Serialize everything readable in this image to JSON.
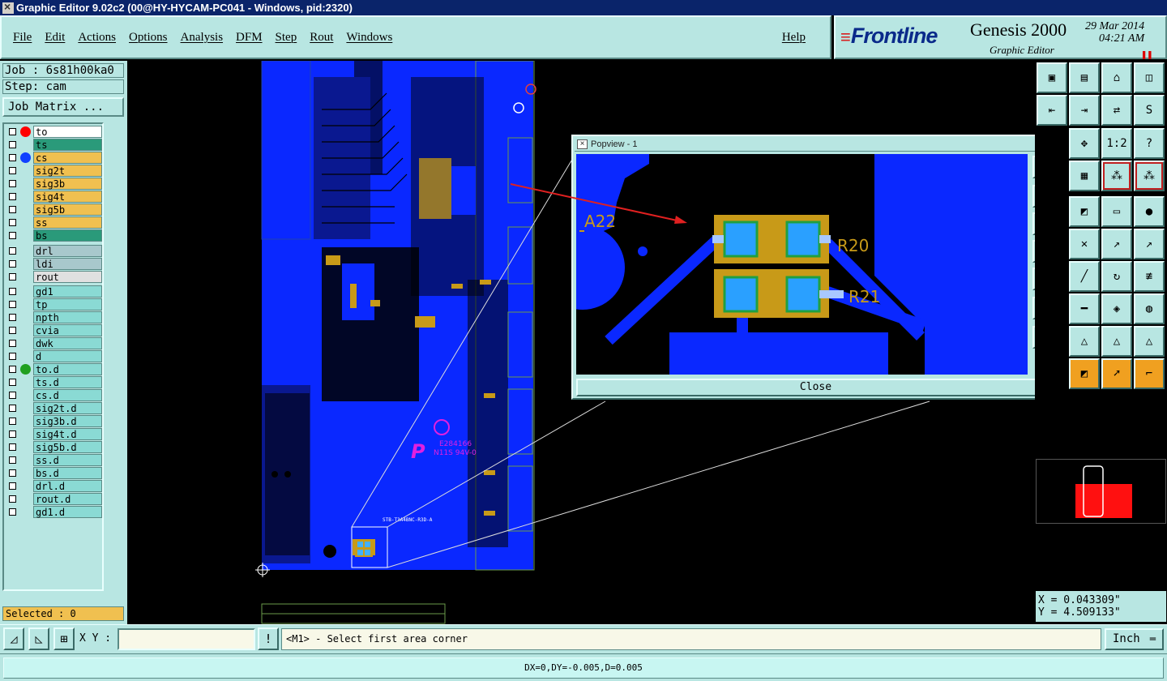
{
  "window": {
    "title": "Graphic Editor 9.02c2 (00@HY-HYCAM-PC041 - Windows, pid:2320)"
  },
  "menu": {
    "items": [
      "File",
      "Edit",
      "Actions",
      "Options",
      "Analysis",
      "DFM",
      "Step",
      "Rout",
      "Windows"
    ],
    "help": "Help"
  },
  "brand": {
    "logo": "Frontline",
    "product": "Genesis 2000",
    "subtitle": "Graphic Editor",
    "date": "29 Mar 2014",
    "time": "04:21 AM"
  },
  "job": {
    "job_label": "Job : 6s81h00ka0",
    "step_label": "Step: cam",
    "matrix_button": "Job Matrix ..."
  },
  "layers": [
    {
      "name": "to",
      "color": "#ffffff",
      "dot": "#ff0000",
      "group": 0
    },
    {
      "name": "ts",
      "color": "#2a9a7a",
      "dot": "",
      "group": 0
    },
    {
      "name": "cs",
      "color": "#f0c050",
      "dot": "#1040ff",
      "group": 0
    },
    {
      "name": "sig2t",
      "color": "#f0c050",
      "dot": "",
      "group": 0
    },
    {
      "name": "sig3b",
      "color": "#f0c050",
      "dot": "",
      "group": 0
    },
    {
      "name": "sig4t",
      "color": "#f0c050",
      "dot": "",
      "group": 0
    },
    {
      "name": "sig5b",
      "color": "#f0c050",
      "dot": "",
      "group": 0
    },
    {
      "name": "ss",
      "color": "#f0c050",
      "dot": "",
      "group": 0
    },
    {
      "name": "bs",
      "color": "#2a9a7a",
      "dot": "",
      "group": 0
    },
    {
      "name": "drl",
      "color": "#a8c8cc",
      "dot": "",
      "group": 1
    },
    {
      "name": "ldi",
      "color": "#a8c8cc",
      "dot": "",
      "group": 1
    },
    {
      "name": "rout",
      "color": "#e0e0e0",
      "dot": "",
      "group": 1
    },
    {
      "name": "gd1",
      "color": "#8adad4",
      "dot": "",
      "group": 2
    },
    {
      "name": "tp",
      "color": "#8adad4",
      "dot": "",
      "group": 2
    },
    {
      "name": "npth",
      "color": "#8adad4",
      "dot": "",
      "group": 2
    },
    {
      "name": "cvia",
      "color": "#8adad4",
      "dot": "",
      "group": 2
    },
    {
      "name": "dwk",
      "color": "#8adad4",
      "dot": "",
      "group": 2
    },
    {
      "name": "d",
      "color": "#8adad4",
      "dot": "",
      "group": 2
    },
    {
      "name": "to.d",
      "color": "#8adad4",
      "dot": "#20a020",
      "group": 2
    },
    {
      "name": "ts.d",
      "color": "#8adad4",
      "dot": "",
      "group": 2
    },
    {
      "name": "cs.d",
      "color": "#8adad4",
      "dot": "",
      "group": 2
    },
    {
      "name": "sig2t.d",
      "color": "#8adad4",
      "dot": "",
      "group": 2
    },
    {
      "name": "sig3b.d",
      "color": "#8adad4",
      "dot": "",
      "group": 2
    },
    {
      "name": "sig4t.d",
      "color": "#8adad4",
      "dot": "",
      "group": 2
    },
    {
      "name": "sig5b.d",
      "color": "#8adad4",
      "dot": "",
      "group": 2
    },
    {
      "name": "ss.d",
      "color": "#8adad4",
      "dot": "",
      "group": 2
    },
    {
      "name": "bs.d",
      "color": "#8adad4",
      "dot": "",
      "group": 2
    },
    {
      "name": "drl.d",
      "color": "#8adad4",
      "dot": "",
      "group": 2
    },
    {
      "name": "rout.d",
      "color": "#8adad4",
      "dot": "",
      "group": 2
    },
    {
      "name": "gd1.d",
      "color": "#8adad4",
      "dot": "",
      "group": 2
    }
  ],
  "selected": "Selected : 0",
  "popview": {
    "title": "Popview - 1",
    "close_x": "X",
    "close_button": "Close",
    "labels": {
      "a22": "A22",
      "r20": "R20",
      "r21": "R21"
    }
  },
  "board_labels": {
    "marking": "E284166",
    "rating": "N11S 94V-0",
    "part": "STB-T3A4BNC-R3D-A"
  },
  "coords": {
    "x": "X = 0.043309\"",
    "y": "Y = 4.509133\""
  },
  "command": {
    "xy_label": "X Y :",
    "xy_value": "",
    "prompt": "<M1> - Select first area corner",
    "unit": "Inch",
    "unit_marker": "═"
  },
  "status": "DX=0,DY=-0.005,D=0.005",
  "colors": {
    "panel": "#b8e6e2",
    "board": "#0a28ff",
    "pad": "#b89018",
    "accent_red": "#e02020"
  }
}
